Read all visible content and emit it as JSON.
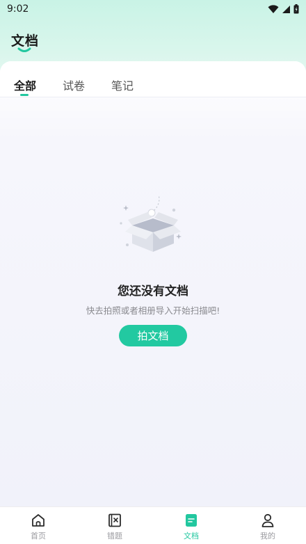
{
  "status_bar": {
    "time": "9:02"
  },
  "header": {
    "title": "文档"
  },
  "tabs": [
    {
      "label": "全部",
      "active": true
    },
    {
      "label": "试卷",
      "active": false
    },
    {
      "label": "笔记",
      "active": false
    }
  ],
  "empty_state": {
    "title": "您还没有文档",
    "subtitle": "快去拍照或者相册导入开始扫描吧!",
    "button_label": "拍文档"
  },
  "bottom_nav": [
    {
      "label": "首页",
      "icon": "home-icon",
      "active": false
    },
    {
      "label": "错题",
      "icon": "wrong-questions-icon",
      "active": false
    },
    {
      "label": "文档",
      "icon": "document-icon",
      "active": true
    },
    {
      "label": "我的",
      "icon": "profile-icon",
      "active": false
    }
  ],
  "colors": {
    "accent": "#22c9a1",
    "header_bg": "#c9f3e6",
    "page_bg": "#f1f2fa"
  }
}
